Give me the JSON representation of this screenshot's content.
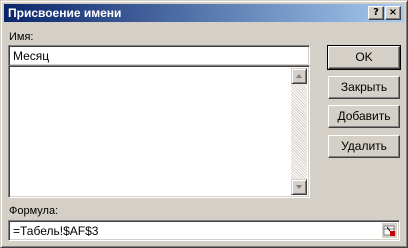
{
  "dialog": {
    "title": "Присвоение имени",
    "help_glyph": "?",
    "close_glyph": "×"
  },
  "name_field": {
    "label": "Имя:",
    "value": "Месяц"
  },
  "formula_field": {
    "label": "Формула:",
    "value": "=Табель!$AF$3"
  },
  "buttons": {
    "ok": "OK",
    "close": "Закрыть",
    "add": "Добавить",
    "delete": "Удалить"
  },
  "names_list": {
    "items": []
  }
}
